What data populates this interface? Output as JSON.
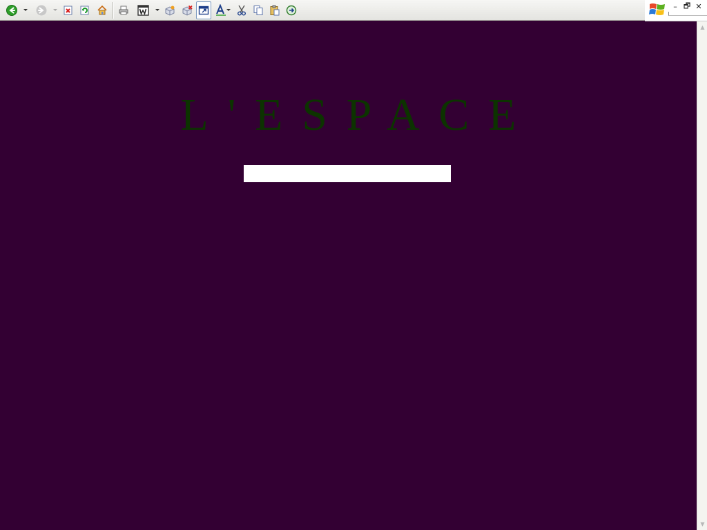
{
  "browser": {
    "toolbar": {
      "buttons": [
        {
          "name": "back-button",
          "icon": "back-arrow-icon",
          "has_dropdown": true
        },
        {
          "name": "forward-button",
          "icon": "forward-arrow-icon",
          "has_dropdown": true,
          "disabled": true
        },
        {
          "name": "stop-button",
          "icon": "stop-icon"
        },
        {
          "name": "refresh-button",
          "icon": "refresh-icon"
        },
        {
          "name": "home-button",
          "icon": "home-icon"
        },
        {
          "name": "print-button",
          "icon": "printer-icon"
        },
        {
          "name": "edit-word-button",
          "icon": "word-icon",
          "has_dropdown": true
        },
        {
          "name": "add-item-button",
          "icon": "box-add-icon"
        },
        {
          "name": "remove-item-button",
          "icon": "box-remove-icon"
        },
        {
          "name": "fullscreen-button",
          "icon": "window-icon",
          "active": true
        },
        {
          "name": "font-size-button",
          "icon": "font-size-icon",
          "has_dropdown": true
        },
        {
          "name": "cut-button",
          "icon": "scissors-icon"
        },
        {
          "name": "copy-button",
          "icon": "copy-icon"
        },
        {
          "name": "paste-button",
          "icon": "paste-icon"
        },
        {
          "name": "go-button",
          "icon": "go-icon"
        }
      ]
    },
    "window_controls": {
      "logo": "windows-logo-icon",
      "minimize_glyph": "–",
      "restore_glyph": "🗗",
      "close_glyph": "✕"
    },
    "scrollbar": {
      "up_glyph": "▲",
      "down_glyph": "▼"
    }
  },
  "page": {
    "title": "L'ESPACE",
    "entry_field": {
      "value": "",
      "placeholder": ""
    },
    "colors": {
      "background": "#330033",
      "title": "#0c3300",
      "field": "#ffffff"
    }
  }
}
